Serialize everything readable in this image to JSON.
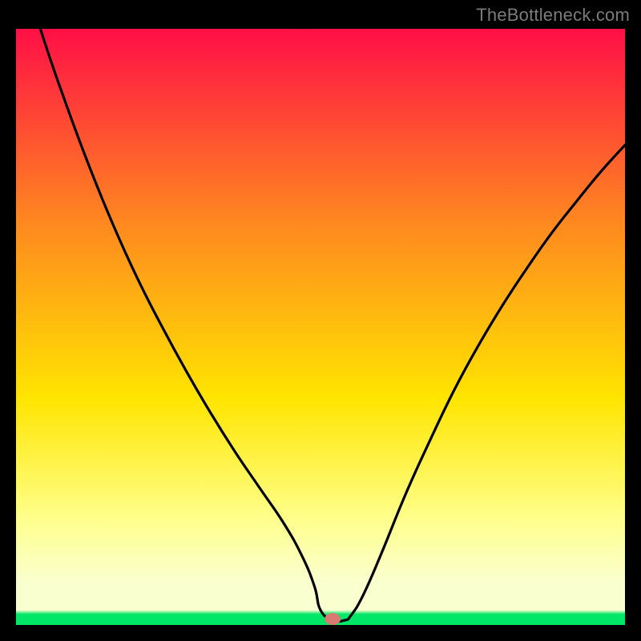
{
  "watermark": "TheBottleneck.com",
  "chart_data": {
    "type": "line",
    "title": "",
    "xlabel": "",
    "ylabel": "",
    "xlim": [
      0,
      100
    ],
    "ylim": [
      0,
      100
    ],
    "gradient_colors": {
      "top": "#ff0f46",
      "upper_mid": "#ff8a1f",
      "mid": "#ffe500",
      "lower_mid": "#ffff8a",
      "near_bottom": "#faffd0",
      "bottom": "#00e667"
    },
    "curve_color": "#000000",
    "marker": {
      "x": 52,
      "y": 1.0,
      "color": "#d97a72"
    },
    "series": [
      {
        "name": "bottleneck-curve",
        "x": [
          0,
          4,
          8,
          12,
          16,
          20,
          24,
          28,
          32,
          36,
          40,
          44,
          47,
          49,
          50,
          52,
          54,
          55,
          57,
          60,
          64,
          68,
          72,
          76,
          80,
          84,
          88,
          92,
          96,
          100
        ],
        "y": [
          114,
          100,
          88,
          77,
          67,
          58,
          50,
          42.5,
          35.5,
          29,
          23,
          17,
          11.5,
          6.5,
          2.5,
          0.8,
          0.8,
          1.6,
          5,
          12,
          22,
          31,
          39.5,
          47,
          53.8,
          60,
          65.8,
          71,
          76,
          80.5
        ]
      }
    ]
  }
}
